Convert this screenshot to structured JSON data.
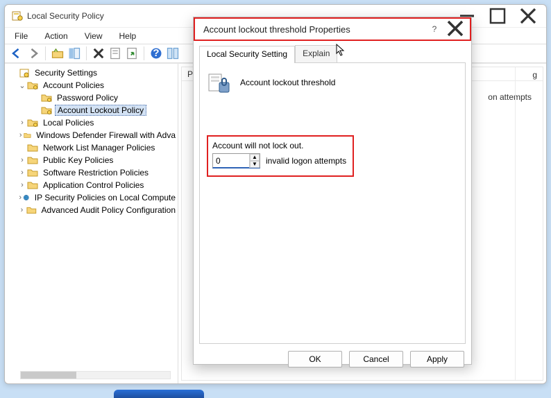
{
  "window": {
    "title": "Local Security Policy",
    "menu": {
      "file": "File",
      "action": "Action",
      "view": "View",
      "help": "Help"
    },
    "win_buttons": {
      "min": "min",
      "max": "max",
      "close": "close"
    }
  },
  "tree": {
    "root": "Security Settings",
    "account_policies": "Account Policies",
    "password_policy": "Password Policy",
    "account_lockout_policy": "Account Lockout Policy",
    "local_policies": "Local Policies",
    "wdf": "Windows Defender Firewall with Adva",
    "nlm": "Network List Manager Policies",
    "pkp": "Public Key Policies",
    "srp": "Software Restriction Policies",
    "acp": "Application Control Policies",
    "ipsec": "IP Security Policies on Local Compute",
    "aap": "Advanced Audit Policy Configuration"
  },
  "list": {
    "header_left_initial": "P",
    "header_right": "g",
    "right_hint": "on attempts"
  },
  "dialog": {
    "title": "Account lockout threshold Properties",
    "help_label": "?",
    "tabs": {
      "setting": "Local Security Setting",
      "explain": "Explain"
    },
    "policy_name": "Account lockout threshold",
    "setting_desc": "Account will not lock out.",
    "spin_value": "0",
    "spin_unit": "invalid logon attempts",
    "buttons": {
      "ok": "OK",
      "cancel": "Cancel",
      "apply": "Apply"
    }
  }
}
